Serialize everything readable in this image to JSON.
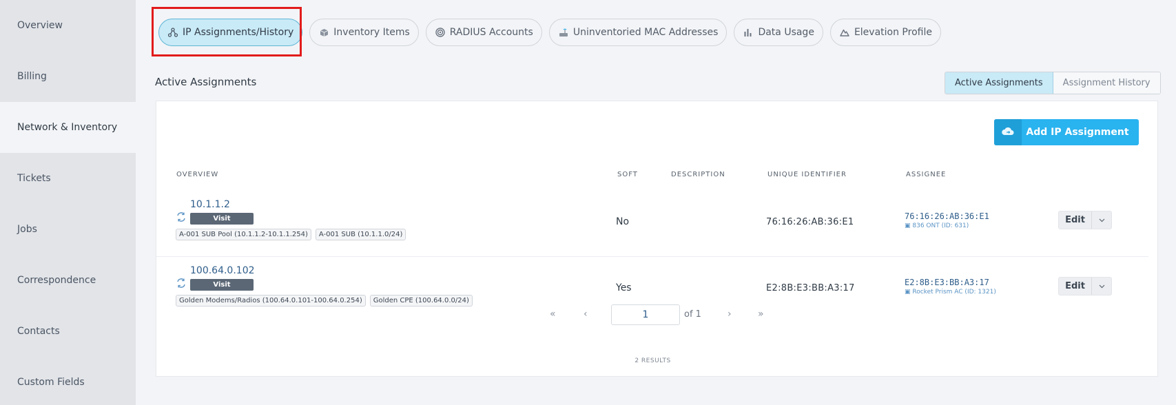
{
  "sidebar": {
    "items": [
      {
        "label": "Overview"
      },
      {
        "label": "Billing"
      },
      {
        "label": "Network & Inventory"
      },
      {
        "label": "Tickets"
      },
      {
        "label": "Jobs"
      },
      {
        "label": "Correspondence"
      },
      {
        "label": "Contacts"
      },
      {
        "label": "Custom Fields"
      }
    ],
    "active": "Network & Inventory"
  },
  "tabs": [
    {
      "label": "IP Assignments/History",
      "icon": "network-icon",
      "glyph": "⚯"
    },
    {
      "label": "Inventory Items",
      "icon": "box-icon",
      "glyph": "▣"
    },
    {
      "label": "RADIUS Accounts",
      "icon": "radar-icon",
      "glyph": "◎"
    },
    {
      "label": "Uninventoried MAC Addresses",
      "icon": "router-icon",
      "glyph": "⌂"
    },
    {
      "label": "Data Usage",
      "icon": "bar-chart-icon",
      "glyph": "▮"
    },
    {
      "label": "Elevation Profile",
      "icon": "mountain-icon",
      "glyph": "△"
    }
  ],
  "active_tab": "IP Assignments/History",
  "highlight_color": "#e21b1b",
  "section": {
    "title": "Active Assignments",
    "toggle": {
      "active": "Active Assignments",
      "other": "Assignment History"
    }
  },
  "add_button": {
    "label": "Add IP Assignment",
    "icon": "cloud-sync-icon",
    "glyph": "☁"
  },
  "table": {
    "headers": {
      "overview": "OVERVIEW",
      "soft": "SOFT",
      "description": "DESCRIPTION",
      "unique_identifier": "UNIQUE IDENTIFIER",
      "assignee": "ASSIGNEE"
    },
    "rows": [
      {
        "ip": "10.1.1.2",
        "visit": "Visit",
        "pools": [
          "A-001 SUB Pool (10.1.1.2-10.1.1.254)",
          "A-001 SUB (10.1.1.0/24)"
        ],
        "soft": "No",
        "description": "",
        "uid": "76:16:26:AB:36:E1",
        "assignee": "76:16:26:AB:36:E1",
        "assignee_sub": "836 ONT (ID: 631)",
        "edit": "Edit"
      },
      {
        "ip": "100.64.0.102",
        "visit": "Visit",
        "pools": [
          "Golden Modems/Radios (100.64.0.101-100.64.0.254)",
          "Golden CPE (100.64.0.0/24)"
        ],
        "soft": "Yes",
        "description": "",
        "uid": "E2:8B:E3:BB:A3:17",
        "assignee": "E2:8B:E3:BB:A3:17",
        "assignee_sub": "Rocket Prism AC (ID: 1321)",
        "edit": "Edit"
      }
    ]
  },
  "pagination": {
    "first": "«",
    "prev": "‹",
    "page": "1",
    "of": "of 1",
    "next": "›",
    "last": "»",
    "results": "2 RESULTS"
  },
  "colors": {
    "accent": "#29b3ef",
    "active_tab_bg": "#c9eaf7",
    "link": "#2e5d8a"
  }
}
